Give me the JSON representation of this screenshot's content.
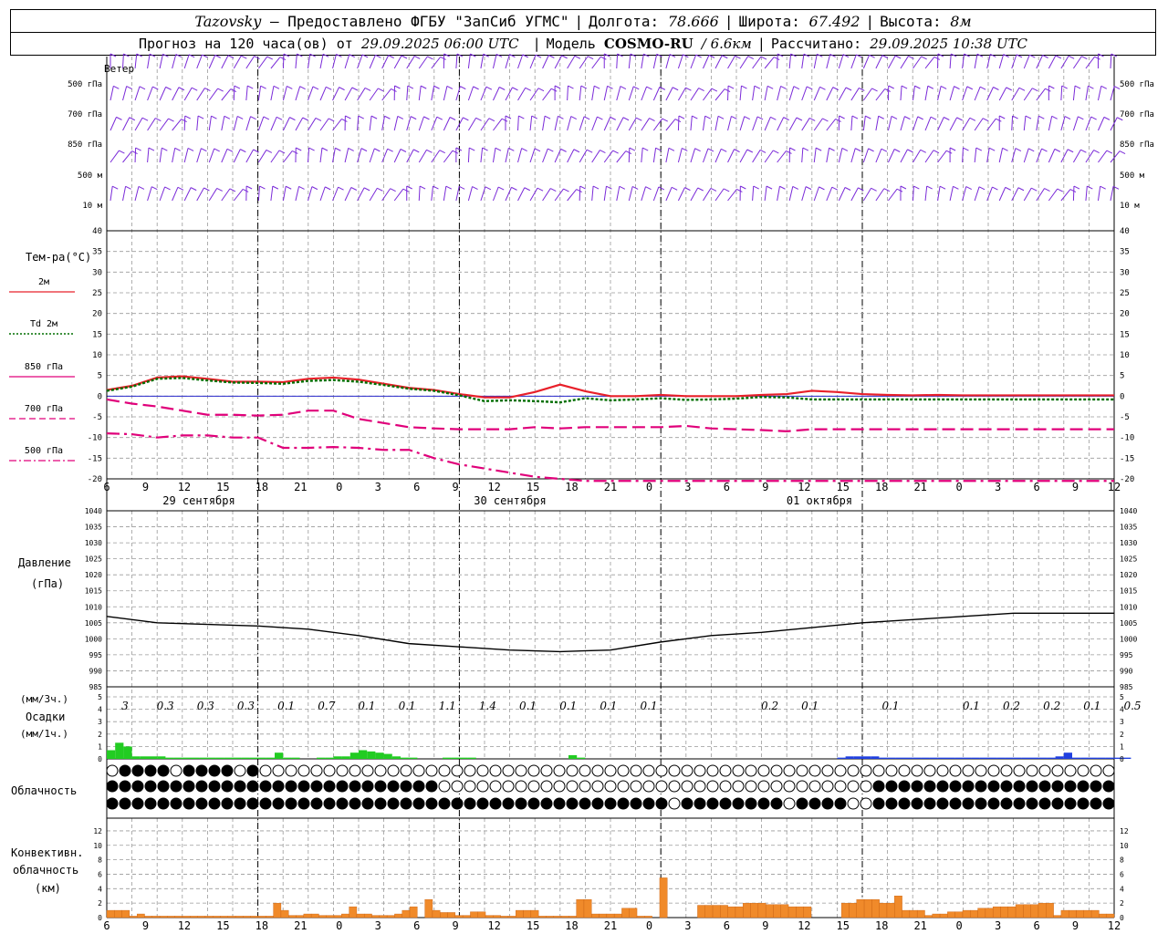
{
  "header": {
    "station": "Tazovsky",
    "provider": "— Предоставлено ФГБУ \"ЗапСиб УГМС\"",
    "lon_label": "Долгота:",
    "lon_value": "78.666",
    "lat_label": "Широта:",
    "lat_value": "67.492",
    "alt_label": "Высота:",
    "alt_value": "8м",
    "forecast_label": "Прогноз на 120 часа(ов) от",
    "forecast_start": "29.09.2025 06:00 UTC",
    "model_label": "Модель",
    "model_name": "COSMO-RU",
    "model_res": "/ 6.6км",
    "computed_label": "Рассчитано:",
    "computed_time": "29.09.2025 10:38 UTC"
  },
  "wind_panel": {
    "title": "Ветер",
    "levels": [
      "500 гПа",
      "700 гПа",
      "850 гПа",
      "500 м",
      "10 м"
    ]
  },
  "temp_panel": {
    "title": "Тем-ра(°C)",
    "legend": [
      {
        "label": "2м",
        "color": "#e8202a",
        "dash": "solid"
      },
      {
        "label": "Td 2м",
        "color": "#006e00",
        "dash": "dotted"
      },
      {
        "label": "850 гПа",
        "color": "#e0007a",
        "dash": "solid"
      },
      {
        "label": "700 гПа",
        "color": "#e0007a",
        "dash": "dashed"
      },
      {
        "label": "500 гПа",
        "color": "#e0007a",
        "dash": "dashdot"
      }
    ],
    "y_ticks": [
      "40",
      "35",
      "30",
      "25",
      "20",
      "15",
      "10",
      "5",
      "0",
      "-5",
      "-10",
      "-15",
      "-20"
    ]
  },
  "x_axis": {
    "hour_ticks": [
      "6",
      "9",
      "12",
      "15",
      "18",
      "21",
      "0",
      "3",
      "6",
      "9",
      "12",
      "15",
      "18",
      "21",
      "0",
      "3",
      "6",
      "9",
      "12",
      "15",
      "18",
      "21",
      "0",
      "3",
      "6",
      "9",
      "12"
    ],
    "dates": [
      "29 сентября",
      "30 сентября",
      "01 октября"
    ]
  },
  "pressure_panel": {
    "title": "Давление",
    "unit": "(гПа)",
    "y_ticks": [
      "1040",
      "1035",
      "1030",
      "1025",
      "1020",
      "1015",
      "1010",
      "1005",
      "1000",
      "995",
      "990",
      "985"
    ]
  },
  "precip_panel": {
    "unit3": "(мм/3ч.)",
    "title": "Осадки",
    "unit1": "(мм/1ч.)",
    "y_ticks": [
      "5",
      "4",
      "3",
      "2",
      "1",
      "0"
    ],
    "totals": [
      "3",
      "0.3",
      "0.3",
      "0.3",
      "0.1",
      "0.7",
      "0.1",
      "0.1",
      "1.1",
      "1.4",
      "0.1",
      "0.1",
      "0.1",
      "0.1",
      "",
      "",
      "0.2",
      "0.1",
      "",
      "0.1",
      "",
      "0.1",
      "0.2",
      "0.2",
      "0.1",
      "0.5"
    ]
  },
  "cloud_panel": {
    "title": "Облачность"
  },
  "conv_panel": {
    "title1": "Конвективн.",
    "title2": "облачность",
    "unit": "(км)",
    "y_ticks": [
      "12",
      "10",
      "8",
      "6",
      "4",
      "2",
      "0"
    ]
  },
  "chart_data": [
    {
      "type": "line",
      "title": "Тем-ра(°C)",
      "ylim": [
        -20,
        40
      ],
      "x_hours": [
        0,
        3,
        6,
        9,
        12,
        15,
        18,
        21,
        24,
        27,
        30,
        33,
        36,
        39,
        42,
        45,
        48,
        51,
        54,
        57,
        60,
        63,
        66,
        69,
        72,
        75,
        78,
        81,
        84,
        87,
        90,
        93,
        96,
        99,
        102,
        105,
        108,
        111,
        114,
        117,
        120
      ],
      "series": [
        {
          "name": "2м",
          "values": [
            1.5,
            2.5,
            4.5,
            4.8,
            4.2,
            3.5,
            3.5,
            3.4,
            4.2,
            4.5,
            4.0,
            3.0,
            2.0,
            1.5,
            0.5,
            -0.3,
            -0.3,
            1.0,
            2.8,
            1.2,
            0,
            0,
            0.3,
            0,
            0,
            0,
            0.3,
            0.5,
            1.3,
            1.0,
            0.5,
            0.3,
            0.2,
            0.3,
            0.2,
            0.2,
            0.2,
            0.2,
            0.2,
            0.2,
            0.2
          ]
        },
        {
          "name": "Td 2м",
          "values": [
            1.3,
            2.3,
            4.2,
            4.4,
            3.8,
            3.3,
            3.2,
            3.0,
            3.7,
            3.9,
            3.5,
            2.7,
            1.8,
            1.3,
            0.2,
            -1.2,
            -1.0,
            -1.2,
            -1.5,
            -0.5,
            -1,
            -0.8,
            -0.5,
            -0.9,
            -0.8,
            -0.6,
            -0.2,
            -0.3,
            -0.8,
            -0.8,
            -0.8,
            -0.8,
            -0.8,
            -0.8,
            -0.8,
            -0.8,
            -0.8,
            -0.8,
            -0.8,
            -0.8,
            -0.8
          ]
        },
        {
          "name": "850 гПа",
          "values": [
            -0.8,
            -1.8,
            -2.5,
            -3.5,
            -4.5,
            -4.5,
            -4.7,
            -4.5,
            -3.5,
            -3.5,
            -5.5,
            -6.5,
            -7.5,
            -7.8,
            -8.0,
            -8.0,
            -8.0,
            -7.5,
            -7.8,
            -7.5,
            -7.5,
            -7.5,
            -7.5,
            -7.2,
            -7.8,
            -8.0,
            -8.2,
            -8.5,
            -8.0,
            -8.0,
            -8.0,
            -8.0,
            -8.0,
            -8.0,
            -8.0,
            -8.0,
            -8.0,
            -8.0,
            -8.0,
            -8.0,
            -8.0
          ]
        },
        {
          "name": "700 гПа",
          "values": [
            -9.0,
            -9.2,
            -10.0,
            -9.5,
            -9.5,
            -10.0,
            -10.0,
            -12.5,
            -12.5,
            -12.3,
            -12.5,
            -13.0,
            -13.0,
            -15.0,
            -16.5,
            -17.5,
            -18.5,
            -19.5,
            -20.0,
            -20.5,
            -20.5,
            -20.5,
            -20.5,
            -20.5,
            -20.5,
            -20.5,
            -20.5,
            -20.5,
            -20.5,
            -20.5,
            -20.5,
            -20.5,
            -20.5,
            -20.5,
            -20.5,
            -20.5,
            -20.5,
            -20.5,
            -20.5,
            -20.5,
            -20.5
          ]
        }
      ]
    },
    {
      "type": "line",
      "title": "Давление",
      "ylim": [
        985,
        1040
      ],
      "x_hours": [
        0,
        6,
        12,
        18,
        24,
        30,
        36,
        42,
        48,
        54,
        60,
        66,
        72,
        78,
        84,
        90,
        96,
        102,
        108,
        114,
        120
      ],
      "series": [
        {
          "name": "Давление",
          "values": [
            1007,
            1005,
            1004.5,
            1004,
            1003,
            1001,
            998.5,
            997.5,
            996.5,
            996,
            996.5,
            999,
            1001,
            1002,
            1003.5,
            1005,
            1006,
            1007,
            1008,
            1008,
            1008
          ]
        }
      ]
    },
    {
      "type": "bar",
      "title": "Осадки",
      "ylim": [
        0,
        5
      ],
      "values": [
        0.7,
        1.3,
        1.0,
        0.2,
        0.2,
        0.2,
        0.2,
        0.1,
        0.1,
        0.1,
        0.1,
        0.1,
        0.1,
        0.1,
        0.1,
        0.1,
        0.1,
        0.1,
        0.1,
        0.1,
        0.5,
        0.1,
        0.1,
        0,
        0,
        0.1,
        0.1,
        0.2,
        0.2,
        0.5,
        0.7,
        0.6,
        0.5,
        0.4,
        0.2,
        0.1,
        0.1,
        0,
        0,
        0,
        0.1,
        0.1,
        0.1,
        0.1,
        0,
        0,
        0,
        0,
        0,
        0,
        0,
        0,
        0,
        0,
        0,
        0.3,
        0.1,
        0,
        0,
        0,
        0,
        0,
        0,
        0,
        0,
        0,
        0,
        0,
        0,
        0,
        0,
        0,
        0,
        0,
        0,
        0,
        0,
        0,
        0,
        0,
        0,
        0,
        0,
        0,
        0,
        0,
        0,
        0.1,
        0.2,
        0.2,
        0.2,
        0.2,
        0.1,
        0.1,
        0.1,
        0.1,
        0.1,
        0.1,
        0.1,
        0.1,
        0.1,
        0.1,
        0.1,
        0.1,
        0.1,
        0.1,
        0.1,
        0.1,
        0.1,
        0.1,
        0.1,
        0.1,
        0.1,
        0.2,
        0.5,
        0.1,
        0.1,
        0.1,
        0.1,
        0.1,
        0.1,
        0.1
      ]
    },
    {
      "type": "bar",
      "title": "Конвективн. облачность",
      "ylim": [
        0,
        13
      ],
      "values": [
        1,
        1,
        1,
        0.2,
        0.5,
        0.2,
        0.2,
        0.2,
        0.2,
        0.2,
        0.2,
        0.2,
        0.2,
        0.2,
        0.2,
        0.2,
        0.2,
        0.2,
        0.2,
        0.2,
        0.2,
        0.2,
        2,
        1,
        0.3,
        0.3,
        0.5,
        0.5,
        0.3,
        0.3,
        0.3,
        0.5,
        1.5,
        0.5,
        0.5,
        0.3,
        0.3,
        0.3,
        0.5,
        1,
        1.5,
        0,
        2.5,
        1,
        0.7,
        0.7,
        0.3,
        0.3,
        0.8,
        0.8,
        0.3,
        0.3,
        0.2,
        0.2,
        1,
        1,
        1,
        0.2,
        0.2,
        0.2,
        0.2,
        0.2,
        2.5,
        2.5,
        0.5,
        0.5,
        0.5,
        0.5,
        1.3,
        1.3,
        0.2,
        0.2,
        0,
        5.5,
        0,
        0,
        0,
        0,
        1.7,
        1.7,
        1.7,
        1.7,
        1.5,
        1.5,
        2,
        2,
        2,
        1.8,
        1.8,
        1.8,
        1.5,
        1.5,
        1.5,
        0,
        0,
        0,
        0,
        2,
        2,
        2.5,
        2.5,
        2.5,
        2,
        2,
        3,
        1,
        1,
        1,
        0.3,
        0.5,
        0.5,
        0.8,
        0.8,
        1,
        1,
        1.3,
        1.3,
        1.5,
        1.5,
        1.5,
        1.8,
        1.8,
        1.8,
        2,
        2,
        0.3,
        1,
        1,
        1,
        1,
        1,
        0.5,
        0.5
      ]
    }
  ]
}
